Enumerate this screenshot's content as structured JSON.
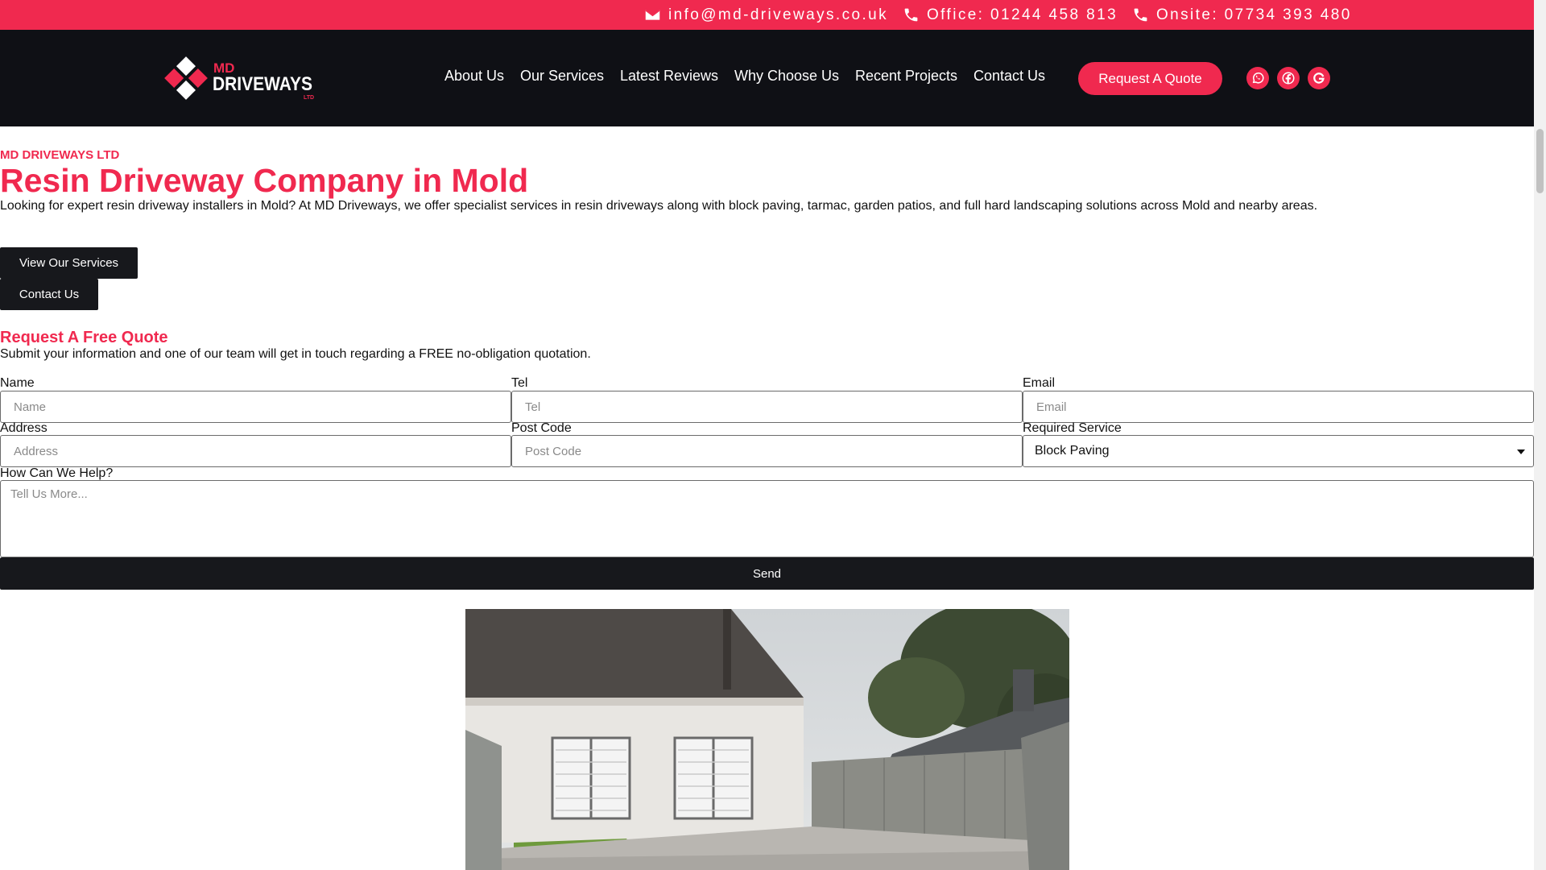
{
  "topbar": {
    "email": "info@md-driveways.co.uk",
    "office": "Office: 01244 458 813",
    "onsite": "Onsite: 07734 393 480"
  },
  "header": {
    "logo": {
      "line1": "MD",
      "line2": "DRIVEWAYS",
      "line3": "LTD"
    },
    "nav": [
      "About Us",
      "Our Services",
      "Latest Reviews",
      "Why Choose Us",
      "Recent Projects",
      "Contact Us"
    ],
    "quote_button": "Request A Quote",
    "socials": [
      "whatsapp-icon",
      "facebook-icon",
      "google-icon"
    ]
  },
  "hero": {
    "eyebrow": "MD DRIVEWAYS LTD",
    "title": "Resin Driveway Company in Mold",
    "lead": "Looking for expert resin driveway installers in Mold? At MD Driveways, we offer specialist services in resin driveways along with block paving, tarmac, garden patios, and full hard landscaping solutions across Mold and nearby areas.",
    "services_button": "View Our Services",
    "contact_button": "Contact Us"
  },
  "form": {
    "title": "Request A Free Quote",
    "intro": "Submit your information and one of our team will get in touch regarding a FREE no-obligation quotation.",
    "fields": {
      "name": {
        "label": "Name",
        "placeholder": "Name"
      },
      "tel": {
        "label": "Tel",
        "placeholder": "Tel"
      },
      "email": {
        "label": "Email",
        "placeholder": "Email"
      },
      "address": {
        "label": "Address",
        "placeholder": "Address"
      },
      "postcode": {
        "label": "Post Code",
        "placeholder": "Post Code"
      },
      "service": {
        "label": "Required Service",
        "value": "Block Paving"
      },
      "message": {
        "label": "How Can We Help?",
        "placeholder": "Tell Us More..."
      }
    },
    "send_label": "Send"
  },
  "colors": {
    "brand": "#f0294f",
    "header_bg": "#0f1015",
    "button_dark": "#17181c"
  }
}
